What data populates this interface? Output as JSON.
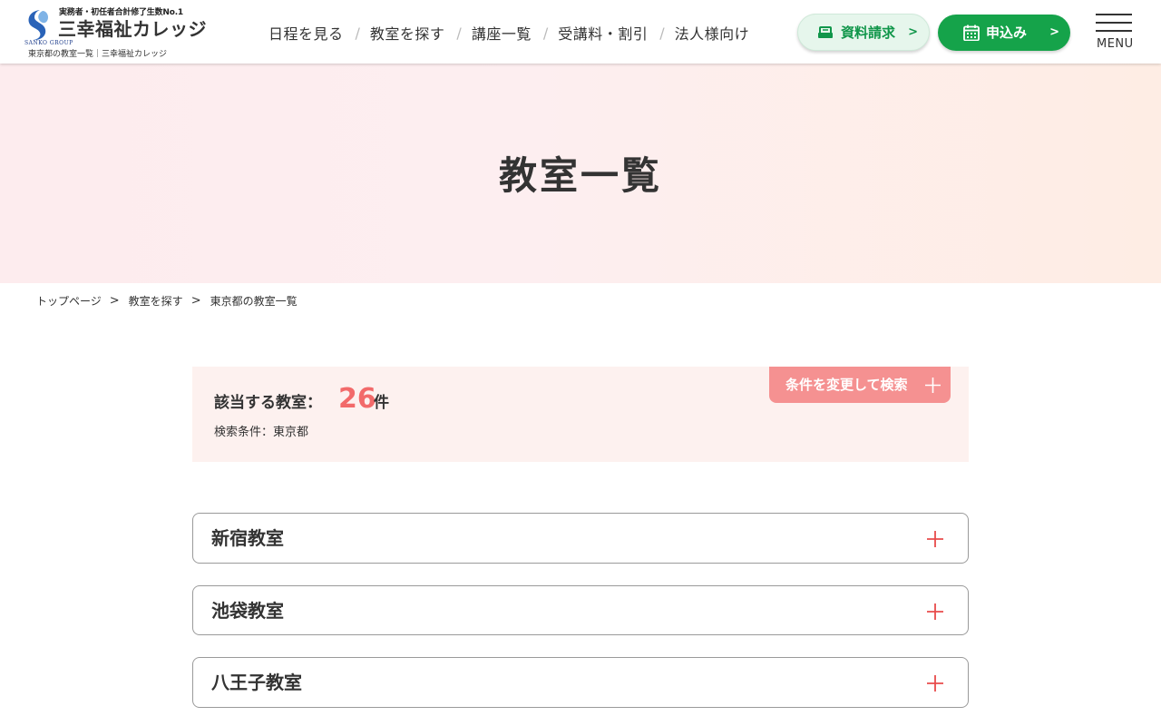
{
  "header": {
    "logo": {
      "catch": "実務者・初任者合計修了生数No.1",
      "name": "三幸福祉カレッジ",
      "english": "SANKO GROUP",
      "page_subtitle": "東京都の教室一覧｜三幸福祉カレッジ"
    },
    "nav": [
      {
        "label": "日程を見る"
      },
      {
        "label": "教室を探す"
      },
      {
        "label": "講座一覧"
      },
      {
        "label": "受講料・割引"
      },
      {
        "label": "法人様向け"
      }
    ],
    "nav_separator": "/",
    "doc_button": {
      "label": "資料請求",
      "arrow": ">",
      "icon": "document-tray-icon"
    },
    "apply_button": {
      "label": "申込み",
      "arrow": ">",
      "icon": "calendar-icon"
    },
    "menu_label": "MENU"
  },
  "hero": {
    "title": "教室一覧"
  },
  "breadcrumb": {
    "items": [
      {
        "label": "トップページ"
      },
      {
        "label": "教室を探す"
      }
    ],
    "separator": ">",
    "current": "東京都の教室一覧"
  },
  "results": {
    "label": "該当する教室：",
    "count": "26",
    "unit": "件",
    "condition": "検索条件：東京都",
    "change_button": "条件を変更して検索"
  },
  "classrooms": [
    {
      "name": "新宿教室"
    },
    {
      "name": "池袋教室"
    },
    {
      "name": "八王子教室"
    }
  ],
  "colors": {
    "brand_green": "#15a34a",
    "accent_pink": "#f26a6a",
    "button_pink": "#f59191",
    "result_bg": "#fdf1ef"
  }
}
